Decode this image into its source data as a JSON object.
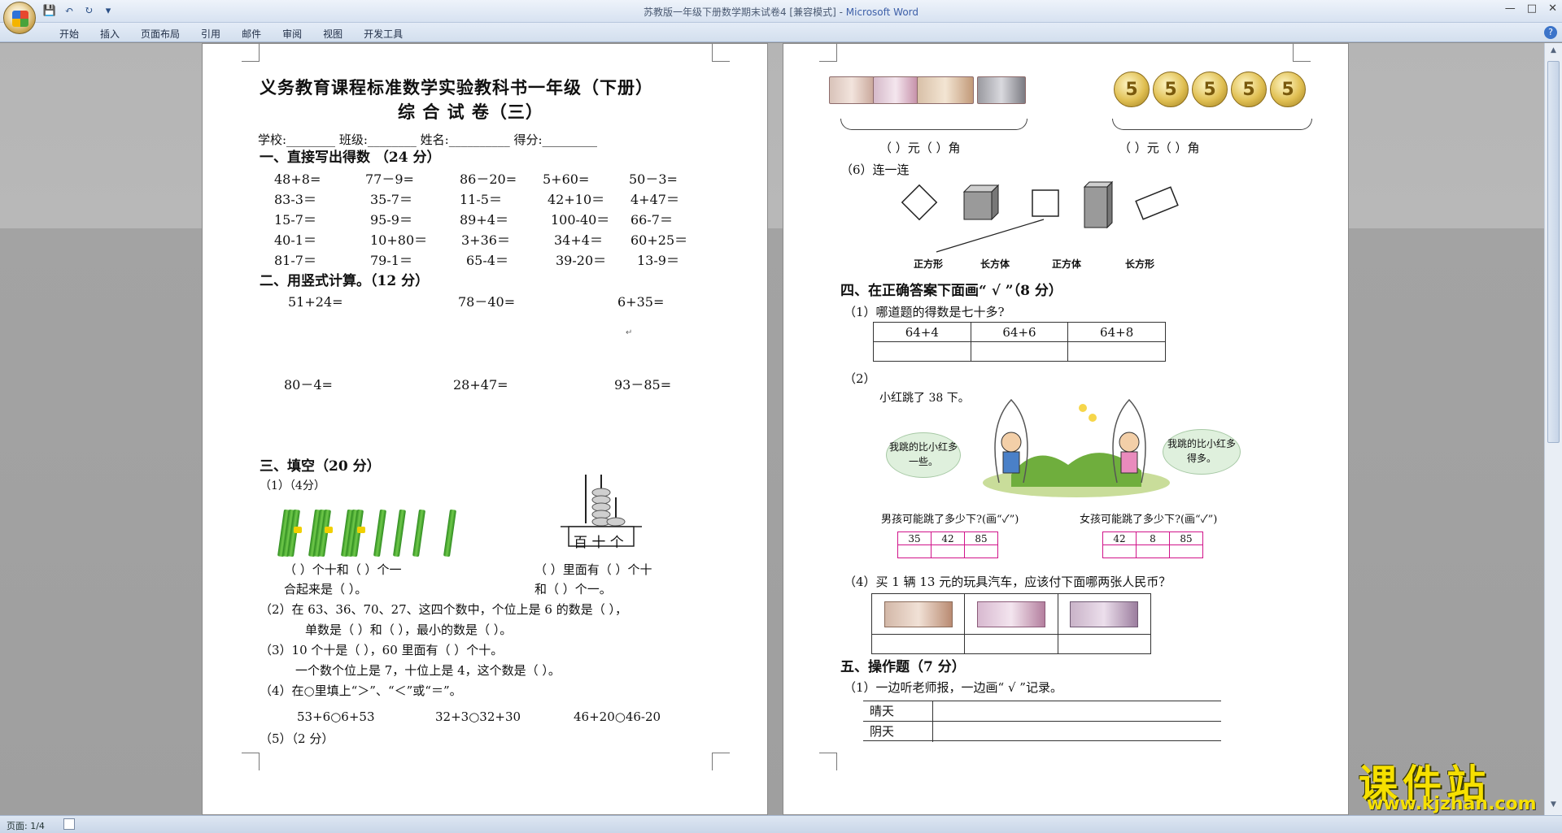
{
  "window": {
    "title_doc": "苏教版一年级下册数学期末试卷4 [兼容模式] - ",
    "title_app": "Microsoft Word"
  },
  "ribbon": {
    "tabs": [
      "开始",
      "插入",
      "页面布局",
      "引用",
      "邮件",
      "审阅",
      "视图",
      "开发工具"
    ]
  },
  "status": {
    "page": "页面: 1/4"
  },
  "watermark": {
    "text": "课件站",
    "url": "www.kjzhan.com"
  },
  "page1": {
    "title1": "义务教育课程标准数学实验教科书一年级（下册）",
    "title2": "综 合 试 卷（三）",
    "info": "学校:________  班级:________  姓名:__________  得分:_________",
    "sec1": "一、直接写出得数  （24 分）",
    "sec1_rows": [
      [
        "48+8=",
        "77－9=",
        "86－20=",
        "5+60=",
        "50－3="
      ],
      [
        "83-3＝",
        "35-7＝",
        "11-5＝",
        "42+10＝",
        "4+47＝"
      ],
      [
        "15-7＝",
        "95-9＝",
        "89+4＝",
        "100-40＝",
        "66-7＝"
      ],
      [
        "40-1＝",
        "10+80＝",
        "3+36＝",
        "34+4＝",
        "60+25＝"
      ],
      [
        "81-7＝",
        "79-1＝",
        "65-4＝",
        "39-20＝",
        "13-9＝"
      ]
    ],
    "sec2": "二、用竖式计算。（12 分）",
    "sec2_row1": [
      "51+24=",
      "78－40=",
      "6+35="
    ],
    "sec2_row2": [
      "80－4=",
      "28+47=",
      "93－85="
    ],
    "sec3": "三、填空（20 分）",
    "q1": "（1）（4分）",
    "abacus_label": "百 十 个",
    "q1_line1a": "（      ）个十和（    ）个一",
    "q1_line2a": "合起来是（     ）。",
    "q1_line1b": "（      ）里面有（      ）个十",
    "q1_line2b": "和（      ）个一。",
    "q2a": "（2）在 63、36、70、27、这四个数中，个位上是 6 的数是（     ），",
    "q2b": "单数是（     ）和（     ），最小的数是（     ）。",
    "q3a": "（3）10 个十是（     ），60 里面有（     ）个十。",
    "q3b": "一个数个位上是 7，十位上是 4，这个数是（     ）。",
    "q4": "（4）在○里填上“＞”、“＜”或“＝”。",
    "q4_items": [
      "53+6○6+53",
      "32+3○32+30",
      "46+20○46-20"
    ],
    "q5": "（5）（2 分）"
  },
  "page2": {
    "money_blank1": "（     ）元（     ）角",
    "money_blank2": "（     ）元（     ）角",
    "coin_value": "5",
    "q6": "（6）连一连",
    "shape_labels": [
      "正方形",
      "长方体",
      "正方体",
      "长方形"
    ],
    "sec4": "四、在正确答案下面画“ √ ”（8 分）",
    "s4q1": "（1）哪道题的得数是七十多?",
    "s4q1_opts": [
      "64+4",
      "64+6",
      "64+8"
    ],
    "s4q2": "（2）",
    "jump_text": "小红跳了 38 下。",
    "bubble_left": "我跳的比小红多一些。",
    "bubble_right": "我跳的比小红多得多。",
    "boy_q": "男孩可能跳了多少下?(画“✓”)",
    "girl_q": "女孩可能跳了多少下?(画“✓”)",
    "boy_opts": [
      "35",
      "42",
      "85"
    ],
    "girl_opts": [
      "42",
      "8",
      "85"
    ],
    "s4q4": "（4）买 1 辆 13 元的玩具汽车，应该付下面哪两张人民币？",
    "sec5": "五、操作题（7 分）",
    "s5q1": "（1）一边听老师报，一边画“ √ ”记录。",
    "weather": [
      "晴天",
      "阴天"
    ]
  }
}
